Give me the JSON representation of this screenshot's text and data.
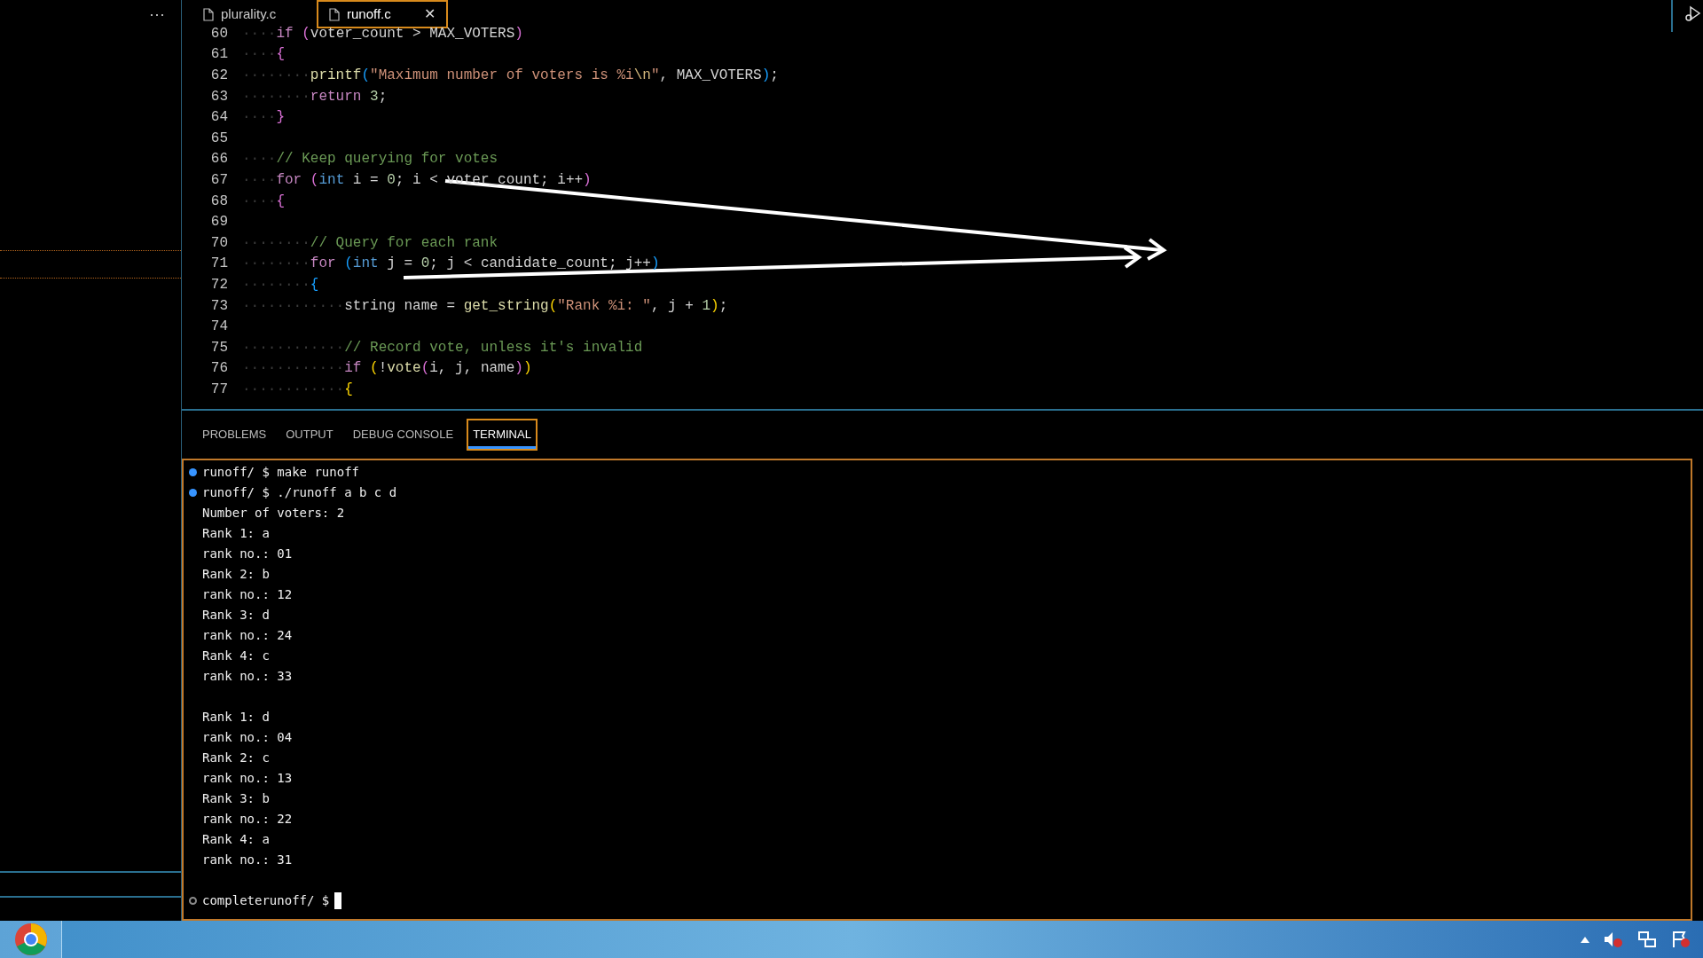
{
  "sidebar": {
    "more": "···"
  },
  "tabs": [
    {
      "label": "plurality.c",
      "selected": false,
      "closable": false
    },
    {
      "label": "runoff.c",
      "selected": true,
      "closable": true
    }
  ],
  "close_symbol": "✕",
  "code": [
    {
      "n": "60",
      "tokens": [
        {
          "t": "····",
          "kind": "whitespace"
        },
        {
          "t": "if ",
          "kind": "keyword"
        },
        {
          "t": "(",
          "kind": "bracket2"
        },
        {
          "t": "voter_count > MAX_VOTERS",
          "kind": "plain"
        },
        {
          "t": ")",
          "kind": "bracket2"
        }
      ]
    },
    {
      "n": "61",
      "tokens": [
        {
          "t": "····",
          "kind": "whitespace"
        },
        {
          "t": "{",
          "kind": "bracket2"
        }
      ]
    },
    {
      "n": "62",
      "tokens": [
        {
          "t": "········",
          "kind": "whitespace"
        },
        {
          "t": "printf",
          "kind": "function"
        },
        {
          "t": "(",
          "kind": "bracket3"
        },
        {
          "t": "\"Maximum number of voters is %i",
          "kind": "string"
        },
        {
          "t": "\\n",
          "kind": "escape"
        },
        {
          "t": "\"",
          "kind": "string"
        },
        {
          "t": ", MAX_VOTERS",
          "kind": "plain"
        },
        {
          "t": ")",
          "kind": "bracket3"
        },
        {
          "t": ";",
          "kind": "plain"
        }
      ]
    },
    {
      "n": "63",
      "tokens": [
        {
          "t": "········",
          "kind": "whitespace"
        },
        {
          "t": "return ",
          "kind": "keyword"
        },
        {
          "t": "3",
          "kind": "number"
        },
        {
          "t": ";",
          "kind": "plain"
        }
      ]
    },
    {
      "n": "64",
      "tokens": [
        {
          "t": "····",
          "kind": "whitespace"
        },
        {
          "t": "}",
          "kind": "bracket2"
        }
      ]
    },
    {
      "n": "65"
    },
    {
      "n": "66",
      "tokens": [
        {
          "t": "····",
          "kind": "whitespace"
        },
        {
          "t": "// Keep querying for votes",
          "kind": "comment"
        }
      ]
    },
    {
      "n": "67",
      "tokens": [
        {
          "t": "····",
          "kind": "whitespace"
        },
        {
          "t": "for ",
          "kind": "keyword"
        },
        {
          "t": "(",
          "kind": "bracket2"
        },
        {
          "t": "int",
          "kind": "type"
        },
        {
          "t": " i = ",
          "kind": "plain"
        },
        {
          "t": "0",
          "kind": "number"
        },
        {
          "t": "; i < voter_count; i++",
          "kind": "plain"
        },
        {
          "t": ")",
          "kind": "bracket2"
        }
      ]
    },
    {
      "n": "68",
      "tokens": [
        {
          "t": "····",
          "kind": "whitespace"
        },
        {
          "t": "{",
          "kind": "bracket2"
        }
      ]
    },
    {
      "n": "69"
    },
    {
      "n": "70",
      "tokens": [
        {
          "t": "········",
          "kind": "whitespace"
        },
        {
          "t": "// Query for each rank",
          "kind": "comment"
        }
      ]
    },
    {
      "n": "71",
      "tokens": [
        {
          "t": "········",
          "kind": "whitespace"
        },
        {
          "t": "for ",
          "kind": "keyword"
        },
        {
          "t": "(",
          "kind": "bracket3"
        },
        {
          "t": "int",
          "kind": "type"
        },
        {
          "t": " j = ",
          "kind": "plain"
        },
        {
          "t": "0",
          "kind": "number"
        },
        {
          "t": "; j < candidate_count; j++",
          "kind": "plain"
        },
        {
          "t": ")",
          "kind": "bracket3"
        }
      ]
    },
    {
      "n": "72",
      "tokens": [
        {
          "t": "········",
          "kind": "whitespace"
        },
        {
          "t": "{",
          "kind": "bracket3"
        }
      ]
    },
    {
      "n": "73",
      "tokens": [
        {
          "t": "············",
          "kind": "whitespace"
        },
        {
          "t": "string name = ",
          "kind": "plain"
        },
        {
          "t": "get_string",
          "kind": "function"
        },
        {
          "t": "(",
          "kind": "bracket1"
        },
        {
          "t": "\"Rank %i: \"",
          "kind": "string"
        },
        {
          "t": ", j + ",
          "kind": "plain"
        },
        {
          "t": "1",
          "kind": "number"
        },
        {
          "t": ")",
          "kind": "bracket1"
        },
        {
          "t": ";",
          "kind": "plain"
        }
      ]
    },
    {
      "n": "74"
    },
    {
      "n": "75",
      "tokens": [
        {
          "t": "············",
          "kind": "whitespace"
        },
        {
          "t": "// Record vote, unless it's invalid",
          "kind": "comment"
        }
      ]
    },
    {
      "n": "76",
      "tokens": [
        {
          "t": "············",
          "kind": "whitespace"
        },
        {
          "t": "if ",
          "kind": "keyword"
        },
        {
          "t": "(",
          "kind": "bracket1"
        },
        {
          "t": "!",
          "kind": "plain"
        },
        {
          "t": "vote",
          "kind": "function"
        },
        {
          "t": "(",
          "kind": "bracket2"
        },
        {
          "t": "i, j, name",
          "kind": "plain"
        },
        {
          "t": ")",
          "kind": "bracket2"
        },
        {
          "t": ")",
          "kind": "bracket1"
        }
      ]
    },
    {
      "n": "77",
      "tokens": [
        {
          "t": "············",
          "kind": "whitespace"
        },
        {
          "t": "{",
          "kind": "bracket1"
        }
      ]
    }
  ],
  "panel_tabs": [
    {
      "label": "PROBLEMS",
      "selected": false
    },
    {
      "label": "OUTPUT",
      "selected": false
    },
    {
      "label": "DEBUG CONSOLE",
      "selected": false
    },
    {
      "label": "TERMINAL",
      "selected": true
    }
  ],
  "terminal": [
    {
      "kind": "command",
      "text": "runoff/ $ make runoff"
    },
    {
      "kind": "command",
      "text": "runoff/ $ ./runoff a b c d"
    },
    {
      "kind": "output",
      "text": "Number of voters: 2"
    },
    {
      "kind": "output",
      "text": "Rank 1: a"
    },
    {
      "kind": "output",
      "text": "rank no.: 01"
    },
    {
      "kind": "output",
      "text": "Rank 2: b"
    },
    {
      "kind": "output",
      "text": "rank no.: 12"
    },
    {
      "kind": "output",
      "text": "Rank 3: d"
    },
    {
      "kind": "output",
      "text": "rank no.: 24"
    },
    {
      "kind": "output",
      "text": "Rank 4: c"
    },
    {
      "kind": "output",
      "text": "rank no.: 33"
    },
    {
      "kind": "blank"
    },
    {
      "kind": "output",
      "text": "Rank 1: d"
    },
    {
      "kind": "output",
      "text": "rank no.: 04"
    },
    {
      "kind": "output",
      "text": "Rank 2: c"
    },
    {
      "kind": "output",
      "text": "rank no.: 13"
    },
    {
      "kind": "output",
      "text": "Rank 3: b"
    },
    {
      "kind": "output",
      "text": "rank no.: 22"
    },
    {
      "kind": "output",
      "text": "Rank 4: a"
    },
    {
      "kind": "output",
      "text": "rank no.: 31"
    },
    {
      "kind": "blank"
    },
    {
      "kind": "prompt",
      "text": "completerunoff/ $"
    }
  ]
}
